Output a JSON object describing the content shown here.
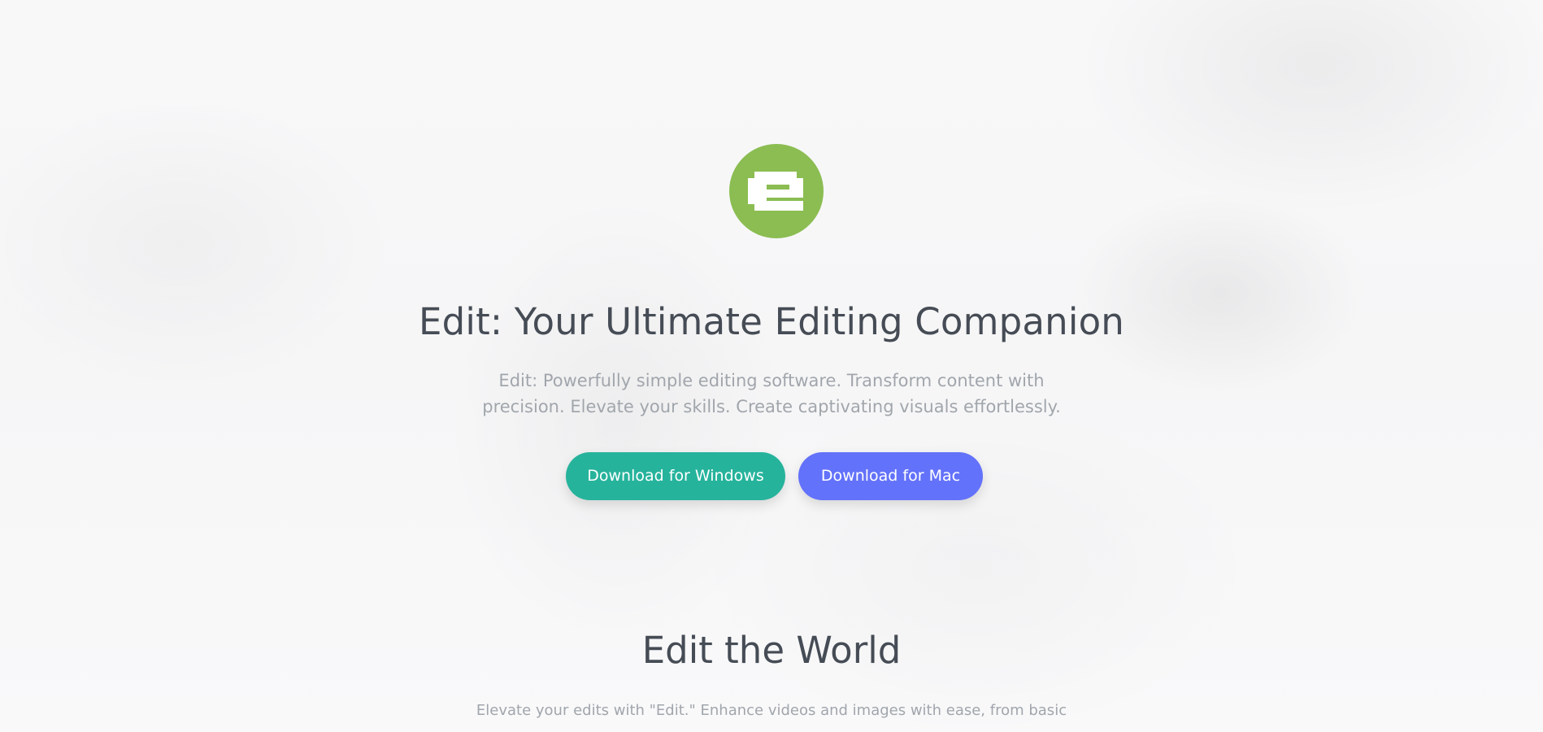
{
  "colors": {
    "logo_background": "#8bbd52",
    "windows_button": "#26b39c",
    "mac_button": "#6372fa",
    "heading_text": "#464c55",
    "body_text": "#a1a6ac"
  },
  "logo": {
    "icon": "edit-logo-icon"
  },
  "hero": {
    "title": "Edit: Your Ultimate Editing Companion",
    "description": "Edit: Powerfully simple editing software. Transform content with precision. Elevate your skills. Create captivating visuals effortlessly.",
    "download_windows_label": "Download for Windows",
    "download_mac_label": "Download for Mac"
  },
  "section": {
    "title": "Edit the World",
    "description": "Elevate your edits with \"Edit.\" Enhance videos and images with ease, from basic"
  }
}
